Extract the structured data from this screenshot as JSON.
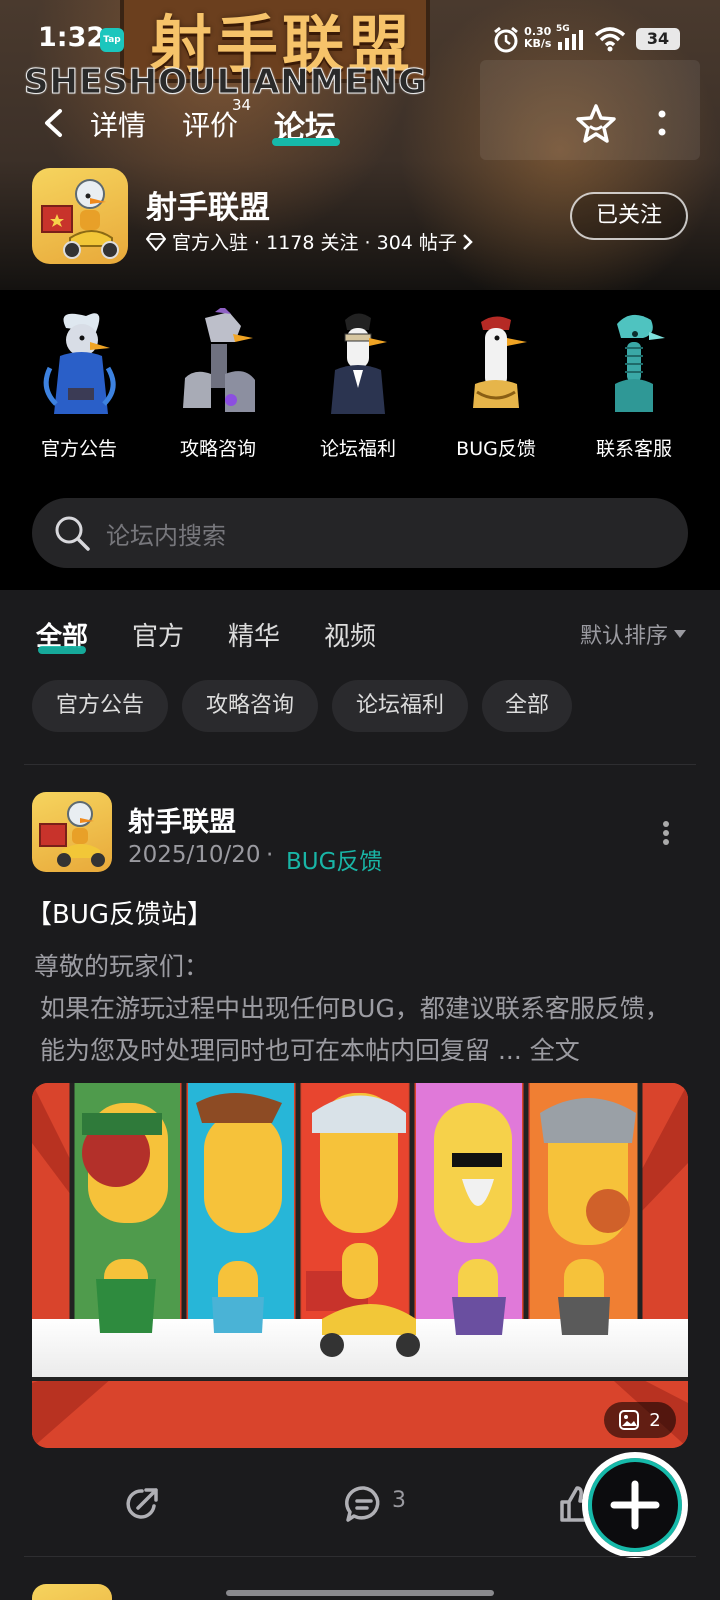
{
  "status_bar": {
    "time": "1:32",
    "tap_badge": "Tap",
    "net_speed_value": "0.30",
    "net_speed_unit": "KB/s",
    "network_type": "5G",
    "battery": "34"
  },
  "banner": {
    "title_cn": "射手联盟",
    "title_en": "SHESHOULIANMENG"
  },
  "nav": {
    "tabs": [
      {
        "label": "详情"
      },
      {
        "label": "评价",
        "badge": "34"
      },
      {
        "label": "论坛"
      }
    ],
    "active_tab": "论坛"
  },
  "game": {
    "name": "射手联盟",
    "meta": "官方入驻 · 1178 关注 · 304 帖子",
    "follow_label": "已关注"
  },
  "categories": [
    {
      "label": "官方公告"
    },
    {
      "label": "攻略咨询"
    },
    {
      "label": "论坛福利"
    },
    {
      "label": "BUG反馈"
    },
    {
      "label": "联系客服"
    }
  ],
  "search": {
    "placeholder": "论坛内搜索"
  },
  "filter_tabs": [
    {
      "label": "全部"
    },
    {
      "label": "官方"
    },
    {
      "label": "精华"
    },
    {
      "label": "视频"
    }
  ],
  "sort_label": "默认排序",
  "chips": [
    {
      "label": "官方公告"
    },
    {
      "label": "攻略咨询"
    },
    {
      "label": "论坛福利"
    },
    {
      "label": "全部"
    }
  ],
  "post": {
    "author": "射手联盟",
    "date": "2025/10/20",
    "separator": "·",
    "tag": "BUG反馈",
    "title": "【BUG反馈站】",
    "body_line1": "尊敬的玩家们：",
    "body_line2": "如果在游玩过程中出现任何BUG，都建议联系客服反馈，能为您及时处理同时也可在本帖内回复留",
    "ellipsis": " ... ",
    "read_more": "全文",
    "image_count": "2",
    "comment_count": "3"
  },
  "colors": {
    "accent": "#16b9a9",
    "tag": "#19b5a6",
    "background": "#1b1b1d",
    "chip_bg": "#2a2a2d"
  }
}
